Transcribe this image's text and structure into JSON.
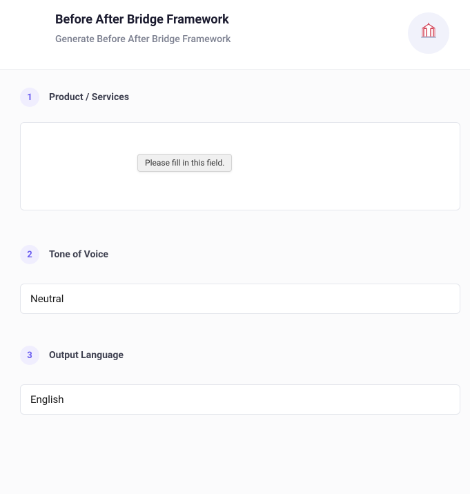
{
  "header": {
    "title": "Before After Bridge Framework",
    "subtitle": "Generate Before After Bridge Framework",
    "icon": "carousel-tent-icon"
  },
  "sections": {
    "product": {
      "number": "1",
      "label": "Product / Services",
      "value": "",
      "tooltip": "Please fill in this field."
    },
    "tone": {
      "number": "2",
      "label": "Tone of Voice",
      "value": "Neutral"
    },
    "language": {
      "number": "3",
      "label": "Output Language",
      "value": "English"
    }
  }
}
